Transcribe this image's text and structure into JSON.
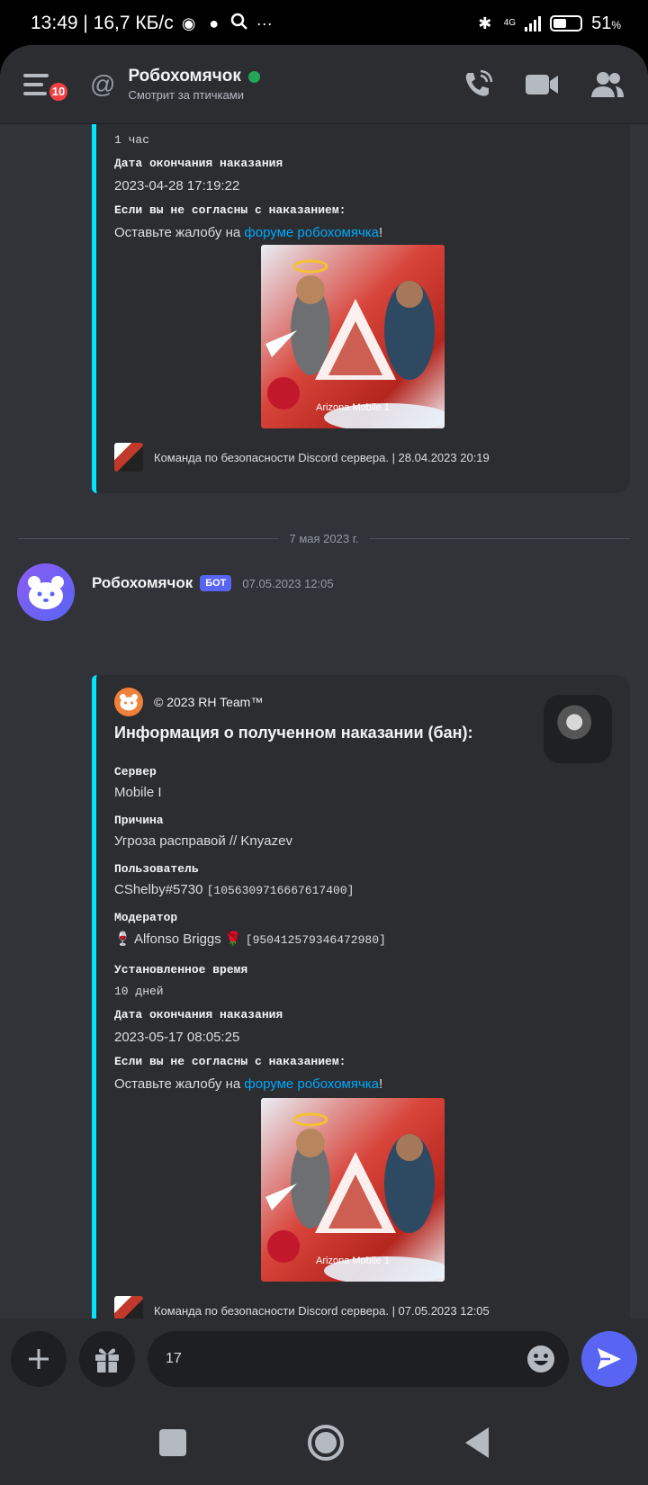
{
  "statusbar": {
    "time_speed": "13:49 | 16,7 КБ/с",
    "network": "4G",
    "battery_pct": 51,
    "battery_text": "51",
    "battery_unit": "%"
  },
  "header": {
    "badge_count": "10",
    "title": "Робохомячок",
    "subtitle": "Смотрит за птичками",
    "status_color": "#23a55a"
  },
  "embed1": {
    "duration_value": "1 час",
    "end_label": "Дата окончания наказания",
    "end_value": "2023-04-28 17:19:22",
    "appeal_label": "Если вы не согласны с наказанием:",
    "appeal_prefix": "Оставьте жалобу на ",
    "appeal_link": "форуме робохомячка",
    "appeal_suffix": "!",
    "image_caption": "Arizona Mobile 1",
    "footer": "Команда по безопасности Discord сервера. | 28.04.2023 20:19"
  },
  "separator": {
    "date": "7 мая 2023 г."
  },
  "message": {
    "author": "Робохомячок",
    "tag": "БОТ",
    "timestamp": "07.05.2023 12:05"
  },
  "embed2": {
    "author": "© 2023 RH Team™",
    "title": "Информация о полученном наказании (бан):",
    "fields": {
      "server_label": "Сервер",
      "server_value": "Mobile I",
      "reason_label": "Причина",
      "reason_value": "Угроза расправой // Knyazev",
      "user_label": "Пользователь",
      "user_name": "CShelby#5730",
      "user_id": "[1056309716667617400]",
      "moderator_label": "Модератор",
      "moderator_emoji_left": "🍷",
      "moderator_name": "Alfonso Briggs",
      "moderator_emoji_right": "🌹",
      "moderator_id": "[950412579346472980]",
      "time_label": "Установленное время",
      "time_value": "10 дней",
      "end_label": "Дата окончания наказания",
      "end_value": "2023-05-17 08:05:25",
      "appeal_label": "Если вы не согласны с наказанием:",
      "appeal_prefix": "Оставьте жалобу на ",
      "appeal_link": "форуме робохомячка",
      "appeal_suffix": "!"
    },
    "image_caption": "Arizona Mobile 1",
    "footer": "Команда по безопасности Discord сервера. | 07.05.2023 12:05"
  },
  "composer": {
    "input_value": "17"
  },
  "colors": {
    "accent": "#5865f2",
    "embed_border": "#00e5ff",
    "link": "#00a8fc"
  },
  "icons": {
    "menu": "hamburger-icon",
    "at": "at-icon",
    "call": "phone-icon",
    "video": "video-camera-icon",
    "members": "members-icon",
    "add": "plus-icon",
    "gift": "gift-icon",
    "emoji": "emoji-icon",
    "send": "send-icon"
  }
}
